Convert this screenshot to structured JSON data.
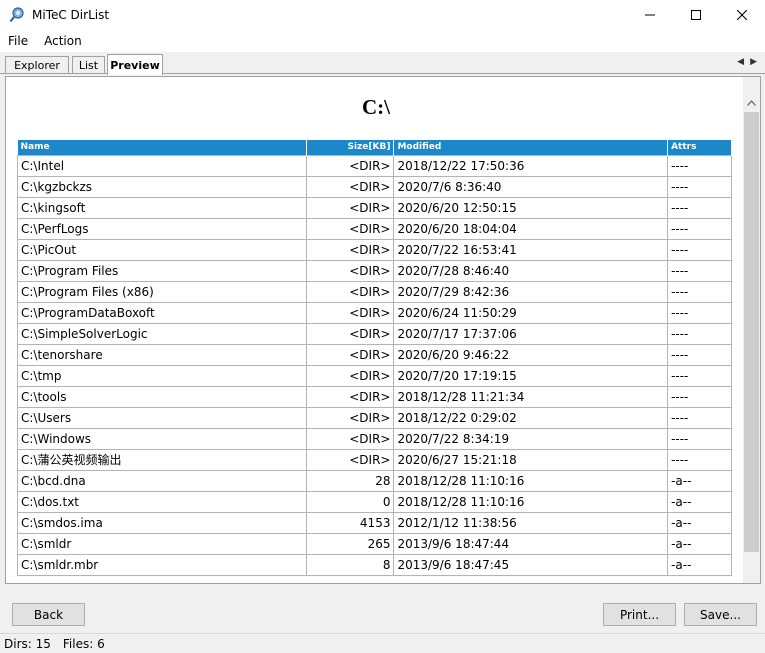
{
  "window": {
    "title": "MiTeC DirList"
  },
  "menu": [
    {
      "label": "File"
    },
    {
      "label": "Action"
    }
  ],
  "tabs": [
    {
      "label": "Explorer"
    },
    {
      "label": "List"
    },
    {
      "label": "Preview"
    }
  ],
  "preview": {
    "title": "C:\\",
    "columns": {
      "name": "Name",
      "size": "Size[KB]",
      "modified": "Modified",
      "attrs": "Attrs"
    },
    "rows": [
      {
        "name": "C:\\Intel",
        "size": "<DIR>",
        "modified": "2018/12/22 17:50:36",
        "attrs": "----"
      },
      {
        "name": "C:\\kgzbckzs",
        "size": "<DIR>",
        "modified": "2020/7/6 8:36:40",
        "attrs": "----"
      },
      {
        "name": "C:\\kingsoft",
        "size": "<DIR>",
        "modified": "2020/6/20 12:50:15",
        "attrs": "----"
      },
      {
        "name": "C:\\PerfLogs",
        "size": "<DIR>",
        "modified": "2020/6/20 18:04:04",
        "attrs": "----"
      },
      {
        "name": "C:\\PicOut",
        "size": "<DIR>",
        "modified": "2020/7/22 16:53:41",
        "attrs": "----"
      },
      {
        "name": "C:\\Program Files",
        "size": "<DIR>",
        "modified": "2020/7/28 8:46:40",
        "attrs": "----"
      },
      {
        "name": "C:\\Program Files (x86)",
        "size": "<DIR>",
        "modified": "2020/7/29 8:42:36",
        "attrs": "----"
      },
      {
        "name": "C:\\ProgramDataBoxoft",
        "size": "<DIR>",
        "modified": "2020/6/24 11:50:29",
        "attrs": "----"
      },
      {
        "name": "C:\\SimpleSolverLogic",
        "size": "<DIR>",
        "modified": "2020/7/17 17:37:06",
        "attrs": "----"
      },
      {
        "name": "C:\\tenorshare",
        "size": "<DIR>",
        "modified": "2020/6/20 9:46:22",
        "attrs": "----"
      },
      {
        "name": "C:\\tmp",
        "size": "<DIR>",
        "modified": "2020/7/20 17:19:15",
        "attrs": "----"
      },
      {
        "name": "C:\\tools",
        "size": "<DIR>",
        "modified": "2018/12/28 11:21:34",
        "attrs": "----"
      },
      {
        "name": "C:\\Users",
        "size": "<DIR>",
        "modified": "2018/12/22 0:29:02",
        "attrs": "----"
      },
      {
        "name": "C:\\Windows",
        "size": "<DIR>",
        "modified": "2020/7/22 8:34:19",
        "attrs": "----"
      },
      {
        "name": "C:\\蒲公英视频输出",
        "size": "<DIR>",
        "modified": "2020/6/27 15:21:18",
        "attrs": "----"
      },
      {
        "name": "C:\\bcd.dna",
        "size": "28",
        "modified": "2018/12/28 11:10:16",
        "attrs": "-a--"
      },
      {
        "name": "C:\\dos.txt",
        "size": "0",
        "modified": "2018/12/28 11:10:16",
        "attrs": "-a--"
      },
      {
        "name": "C:\\smdos.ima",
        "size": "4153",
        "modified": "2012/1/12 11:38:56",
        "attrs": "-a--"
      },
      {
        "name": "C:\\smldr",
        "size": "265",
        "modified": "2013/9/6 18:47:44",
        "attrs": "-a--"
      },
      {
        "name": "C:\\smldr.mbr",
        "size": "8",
        "modified": "2013/9/6 18:47:45",
        "attrs": "-a--"
      }
    ]
  },
  "buttons": {
    "back": "Back",
    "print": "Print...",
    "save": "Save..."
  },
  "status": {
    "dirs": "Dirs: 15",
    "files": "Files: 6"
  },
  "colors": {
    "header": "#1c87c9"
  }
}
